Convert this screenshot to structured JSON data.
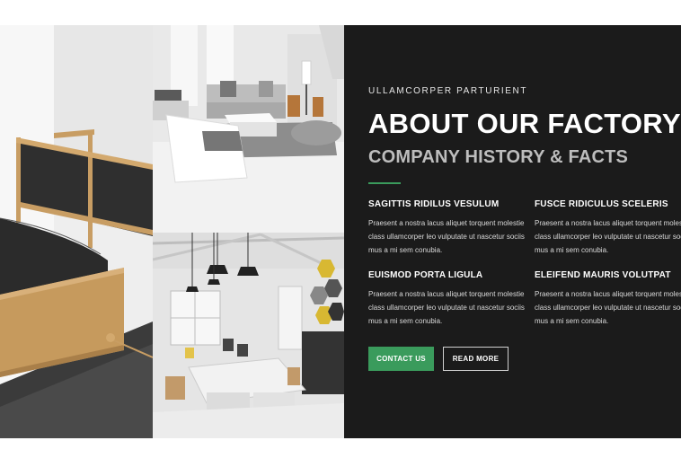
{
  "hero": {
    "eyebrow": "ULLAMCORPER PARTURIENT",
    "title": "ABOUT OUR FACTORY",
    "subtitle": "COMPANY HISTORY & FACTS",
    "accent_color": "#3a9b5c",
    "background_color": "#1b1b1b"
  },
  "features": [
    {
      "title": "SAGITTIS RIDILUS VESULUM",
      "text": "Praesent a nostra lacus aliquet torquent molestie class ullamcorper leo vulputate ut nascetur sociis mus a mi sem conubia."
    },
    {
      "title": "FUSCE RIDICULUS SCELERIS",
      "text": "Praesent a nostra lacus aliquet torquent molestie class ullamcorper leo vulputate ut nascetur sociis mus a mi sem conubia."
    },
    {
      "title": "EUISMOD PORTA LIGULA",
      "text": "Praesent a nostra lacus aliquet torquent molestie class ullamcorper leo vulputate ut nascetur sociis mus a mi sem conubia."
    },
    {
      "title": "ELEIFEND MAURIS VOLUTPAT",
      "text": "Praesent a nostra lacus aliquet torquent molestie class ullamcorper leo vulputate ut nascetur sociis mus a mi sem conubia."
    }
  ],
  "buttons": {
    "contact": "CONTACT US",
    "read_more": "READ MORE"
  },
  "images": {
    "left": "bed-photo",
    "top_right": "living-room-photo",
    "bottom_right": "office-photo"
  }
}
